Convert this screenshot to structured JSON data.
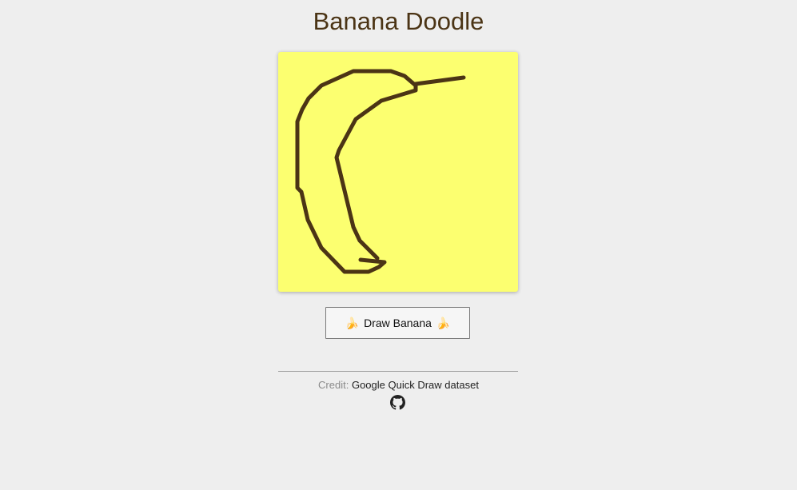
{
  "header": {
    "title": "Banana Doodle"
  },
  "doodle": {
    "background": "#fcff70",
    "stroke_color": "#4b3415"
  },
  "actions": {
    "draw_label": "Draw Banana",
    "emoji": "🍌"
  },
  "footer": {
    "credit_label": "Credit:",
    "credit_link": "Google Quick Draw dataset",
    "github_icon": "github-icon"
  },
  "colors": {
    "page_background": "#eeeeee",
    "title": "#4b3415"
  }
}
